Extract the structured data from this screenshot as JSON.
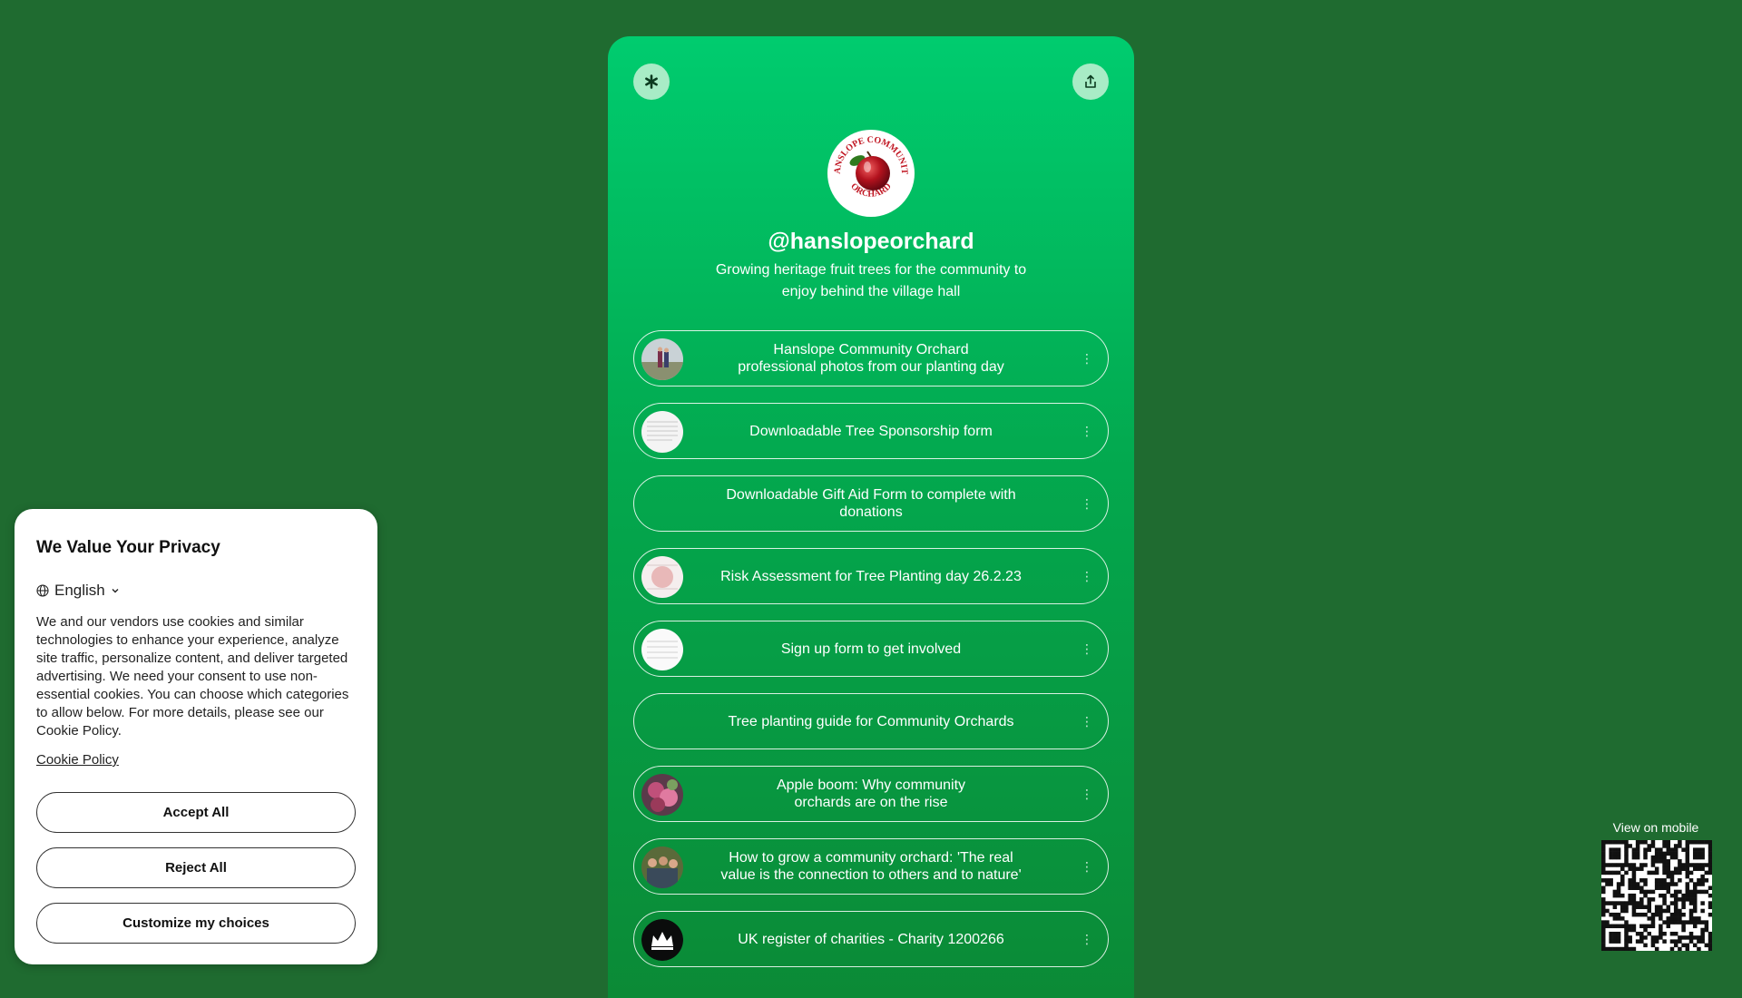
{
  "profile": {
    "handle": "@hanslopeorchard",
    "bio": "Growing heritage fruit trees for the community to enjoy behind the village hall",
    "logo_text_top": "HANSLOPE COMMUNITY",
    "logo_text_bottom": "ORCHARD"
  },
  "links": [
    {
      "label": "Hanslope Community Orchard\nprofessional photos from our planting day",
      "thumb": "photo-people"
    },
    {
      "label": "Downloadable Tree Sponsorship form",
      "thumb": "document"
    },
    {
      "label": "Downloadable Gift Aid Form to complete with donations",
      "thumb": null
    },
    {
      "label": "Risk Assessment for Tree Planting day 26.2.23",
      "thumb": "document-red"
    },
    {
      "label": "Sign up form to get involved",
      "thumb": "document"
    },
    {
      "label": "Tree planting guide for Community Orchards",
      "thumb": null
    },
    {
      "label": "Apple boom: Why community\norchards are on the rise",
      "thumb": "apples"
    },
    {
      "label": "How to grow a community orchard: 'The real\nvalue is the connection to others and to nature'",
      "thumb": "photo-group"
    },
    {
      "label": "UK register of charities - Charity 1200266",
      "thumb": "crown"
    }
  ],
  "cookie": {
    "title": "We Value Your Privacy",
    "language": "English",
    "text": "We and our vendors use cookies and similar technologies to enhance your experience, analyze site traffic, personalize content, and deliver targeted advertising. We need your consent to use non-essential cookies. You can choose which categories to allow below. For more details, please see our Cookie Policy.",
    "policy_link": "Cookie Policy",
    "accept": "Accept All",
    "reject": "Reject All",
    "customize": "Customize my choices"
  },
  "qr": {
    "label": "View on mobile"
  },
  "colors": {
    "background": "#1f6b30",
    "card_top": "#00cc6f",
    "card_bottom": "#0b8a36"
  }
}
